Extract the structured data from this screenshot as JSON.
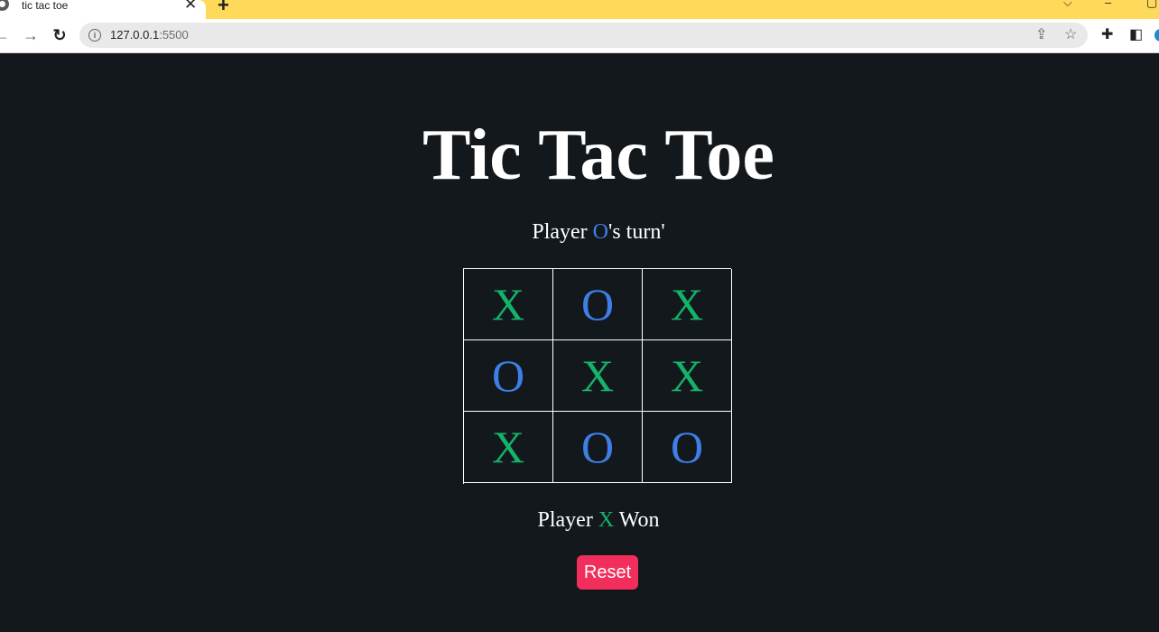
{
  "browser": {
    "tab_title": "tic tac toe",
    "tab_close": "✕",
    "new_tab": "+",
    "url_host": "127.0.0.1",
    "url_port": ":5500",
    "icons": [
      "back-icon",
      "forward-icon",
      "reload-icon",
      "info-icon",
      "share-icon",
      "star-icon",
      "extensions-icon",
      "sidebar-icon",
      "profile-icon"
    ]
  },
  "game": {
    "title": "Tic Tac Toe",
    "turn_prefix": "Player ",
    "turn_mark": "O",
    "turn_suffix": "'s turn'",
    "board": [
      [
        "X",
        "O",
        "X"
      ],
      [
        "O",
        "X",
        "X"
      ],
      [
        "X",
        "O",
        "O"
      ]
    ],
    "result_prefix": "Player ",
    "result_mark": "X",
    "result_suffix": " Won",
    "reset_label": "Reset"
  },
  "colors": {
    "background": "#13181d",
    "x_color": "#14b36a",
    "o_color": "#3d7fe6",
    "reset_button": "#f22f5c",
    "tabstrip": "#ffd95a"
  }
}
